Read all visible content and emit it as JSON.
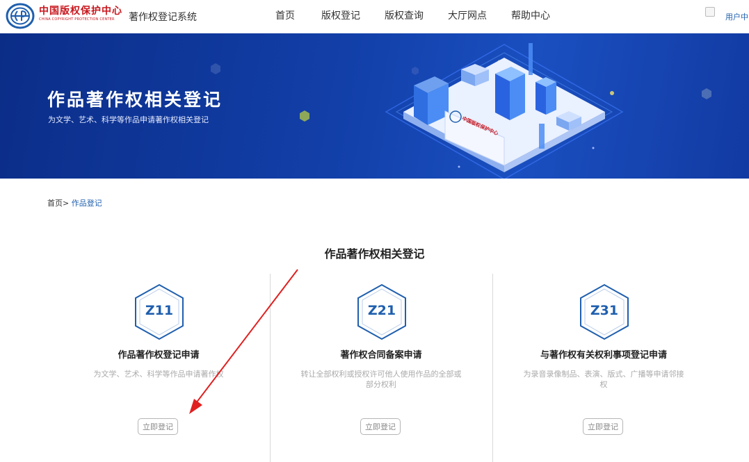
{
  "header": {
    "logo_cn": "中国版权保护中心",
    "logo_en": "CHINA COPYRIGHT PROTECTION CENTER",
    "system_name": "著作权登记系统",
    "nav": [
      {
        "label": "首页"
      },
      {
        "label": "版权登记"
      },
      {
        "label": "版权查询"
      },
      {
        "label": "大厅网点"
      },
      {
        "label": "帮助中心"
      }
    ],
    "user_label": "用户中"
  },
  "banner": {
    "title": "作品著作权相关登记",
    "subtitle": "为文学、艺术、科学等作品申请著作权相关登记",
    "sign_text": "中国版权保护中心"
  },
  "breadcrumb": {
    "home": "首页",
    "separator": ">",
    "current": "作品登记"
  },
  "section": {
    "title": "作品著作权相关登记"
  },
  "cards": [
    {
      "code": "Z11",
      "title": "作品著作权登记申请",
      "desc": "为文学、艺术、科学等作品申请著作权",
      "button": "立即登记"
    },
    {
      "code": "Z21",
      "title": "著作权合同备案申请",
      "desc": "转让全部权利或授权许可他人使用作品的全部或部分权利",
      "button": "立即登记"
    },
    {
      "code": "Z31",
      "title": "与著作权有关权利事项登记申请",
      "desc": "为录音录像制品、表演、版式、广播等申请邻接权",
      "button": "立即登记"
    }
  ],
  "colors": {
    "brand_red": "#c8161d",
    "link_blue": "#1f5fae",
    "banner_blue": "#123fa8",
    "annotation_red": "#e02020"
  }
}
